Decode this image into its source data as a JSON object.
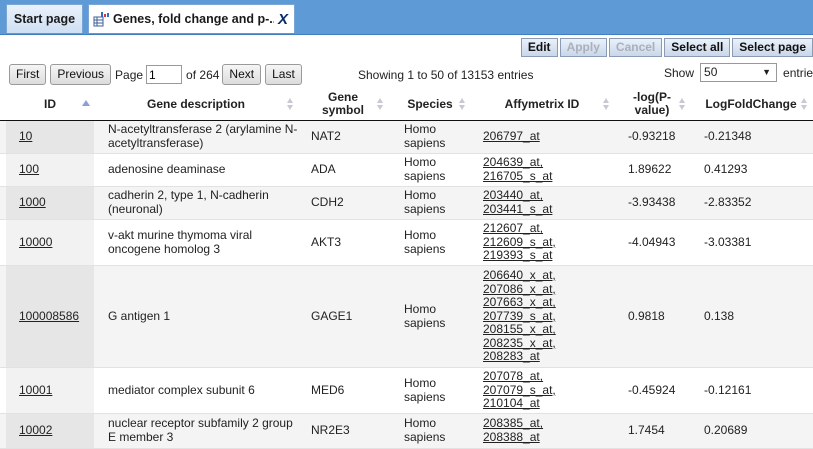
{
  "tabs": [
    {
      "label": "Start page"
    },
    {
      "label": "Genes, fold change and p-...",
      "close": "X"
    }
  ],
  "toolbar": {
    "edit": "Edit",
    "apply": "Apply",
    "cancel": "Cancel",
    "select_all": "Select all",
    "select_page": "Select page"
  },
  "pager": {
    "first": "First",
    "previous": "Previous",
    "page_label": "Page",
    "page_value": "1",
    "of_text": "of 264",
    "next": "Next",
    "last": "Last",
    "showing": "Showing 1 to 50 of 13153 entries",
    "show_label": "Show",
    "show_value": "50",
    "entries_label": "entries"
  },
  "columns": [
    "ID",
    "Gene description",
    "Gene symbol",
    "Species",
    "Affymetrix ID",
    "-log(P-value)",
    "LogFoldChange"
  ],
  "rows": [
    {
      "id": "10",
      "desc": "N-acetyltransferase 2 (arylamine N-acetyltransferase)",
      "symbol": "NAT2",
      "species": "Homo sapiens",
      "affy": [
        "206797_at"
      ],
      "logp": "-0.93218",
      "lfc": "-0.21348"
    },
    {
      "id": "100",
      "desc": "adenosine deaminase",
      "symbol": "ADA",
      "species": "Homo sapiens",
      "affy": [
        "204639_at,",
        "216705_s_at"
      ],
      "logp": "1.89622",
      "lfc": "0.41293"
    },
    {
      "id": "1000",
      "desc": "cadherin 2, type 1, N-cadherin (neuronal)",
      "symbol": "CDH2",
      "species": "Homo sapiens",
      "affy": [
        "203440_at,",
        "203441_s_at"
      ],
      "logp": "-3.93438",
      "lfc": "-2.83352"
    },
    {
      "id": "10000",
      "desc": "v-akt murine thymoma viral oncogene homolog 3",
      "symbol": "AKT3",
      "species": "Homo sapiens",
      "affy": [
        "212607_at,",
        "212609_s_at,",
        "219393_s_at"
      ],
      "logp": "-4.04943",
      "lfc": "-3.03381"
    },
    {
      "id": "100008586",
      "desc": "G antigen 1",
      "symbol": "GAGE1",
      "species": "Homo sapiens",
      "affy": [
        "206640_x_at,",
        "207086_x_at,",
        "207663_x_at,",
        "207739_s_at,",
        "208155_x_at,",
        "208235_x_at,",
        "208283_at"
      ],
      "logp": "0.9818",
      "lfc": "0.138"
    },
    {
      "id": "10001",
      "desc": "mediator complex subunit 6",
      "symbol": "MED6",
      "species": "Homo sapiens",
      "affy": [
        "207078_at,",
        "207079_s_at,",
        "210104_at"
      ],
      "logp": "-0.45924",
      "lfc": "-0.12161"
    },
    {
      "id": "10002",
      "desc": "nuclear receptor subfamily 2 group E member 3",
      "symbol": "NR2E3",
      "species": "Homo sapiens",
      "affy": [
        "208385_at,",
        "208388_at"
      ],
      "logp": "1.7454",
      "lfc": "0.20689"
    }
  ],
  "colors": {
    "tabbar": "#5d9ad6",
    "row_alt": "#f4f4f4",
    "sort_active": "#8d9fd8"
  }
}
